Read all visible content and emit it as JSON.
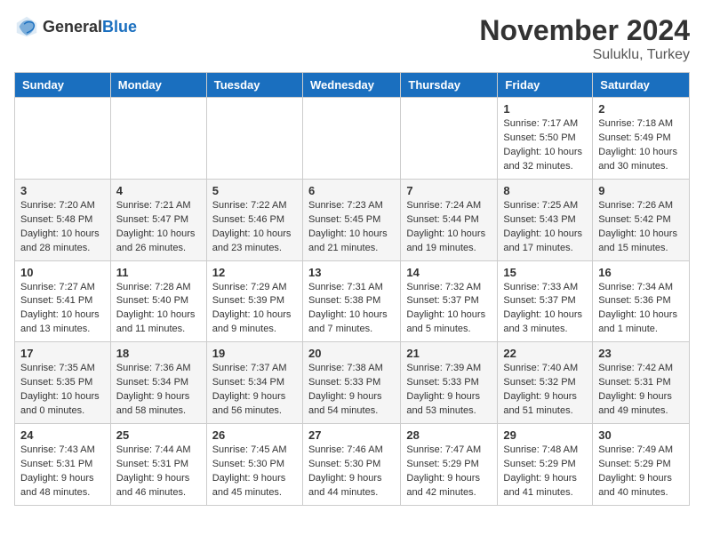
{
  "logo": {
    "text_general": "General",
    "text_blue": "Blue",
    "tagline": "GeneralBlue"
  },
  "title": "November 2024",
  "location": "Suluklu, Turkey",
  "days_of_week": [
    "Sunday",
    "Monday",
    "Tuesday",
    "Wednesday",
    "Thursday",
    "Friday",
    "Saturday"
  ],
  "rows": [
    [
      {
        "day": "",
        "info": ""
      },
      {
        "day": "",
        "info": ""
      },
      {
        "day": "",
        "info": ""
      },
      {
        "day": "",
        "info": ""
      },
      {
        "day": "",
        "info": ""
      },
      {
        "day": "1",
        "info": "Sunrise: 7:17 AM\nSunset: 5:50 PM\nDaylight: 10 hours and 32 minutes."
      },
      {
        "day": "2",
        "info": "Sunrise: 7:18 AM\nSunset: 5:49 PM\nDaylight: 10 hours and 30 minutes."
      }
    ],
    [
      {
        "day": "3",
        "info": "Sunrise: 7:20 AM\nSunset: 5:48 PM\nDaylight: 10 hours and 28 minutes."
      },
      {
        "day": "4",
        "info": "Sunrise: 7:21 AM\nSunset: 5:47 PM\nDaylight: 10 hours and 26 minutes."
      },
      {
        "day": "5",
        "info": "Sunrise: 7:22 AM\nSunset: 5:46 PM\nDaylight: 10 hours and 23 minutes."
      },
      {
        "day": "6",
        "info": "Sunrise: 7:23 AM\nSunset: 5:45 PM\nDaylight: 10 hours and 21 minutes."
      },
      {
        "day": "7",
        "info": "Sunrise: 7:24 AM\nSunset: 5:44 PM\nDaylight: 10 hours and 19 minutes."
      },
      {
        "day": "8",
        "info": "Sunrise: 7:25 AM\nSunset: 5:43 PM\nDaylight: 10 hours and 17 minutes."
      },
      {
        "day": "9",
        "info": "Sunrise: 7:26 AM\nSunset: 5:42 PM\nDaylight: 10 hours and 15 minutes."
      }
    ],
    [
      {
        "day": "10",
        "info": "Sunrise: 7:27 AM\nSunset: 5:41 PM\nDaylight: 10 hours and 13 minutes."
      },
      {
        "day": "11",
        "info": "Sunrise: 7:28 AM\nSunset: 5:40 PM\nDaylight: 10 hours and 11 minutes."
      },
      {
        "day": "12",
        "info": "Sunrise: 7:29 AM\nSunset: 5:39 PM\nDaylight: 10 hours and 9 minutes."
      },
      {
        "day": "13",
        "info": "Sunrise: 7:31 AM\nSunset: 5:38 PM\nDaylight: 10 hours and 7 minutes."
      },
      {
        "day": "14",
        "info": "Sunrise: 7:32 AM\nSunset: 5:37 PM\nDaylight: 10 hours and 5 minutes."
      },
      {
        "day": "15",
        "info": "Sunrise: 7:33 AM\nSunset: 5:37 PM\nDaylight: 10 hours and 3 minutes."
      },
      {
        "day": "16",
        "info": "Sunrise: 7:34 AM\nSunset: 5:36 PM\nDaylight: 10 hours and 1 minute."
      }
    ],
    [
      {
        "day": "17",
        "info": "Sunrise: 7:35 AM\nSunset: 5:35 PM\nDaylight: 10 hours and 0 minutes."
      },
      {
        "day": "18",
        "info": "Sunrise: 7:36 AM\nSunset: 5:34 PM\nDaylight: 9 hours and 58 minutes."
      },
      {
        "day": "19",
        "info": "Sunrise: 7:37 AM\nSunset: 5:34 PM\nDaylight: 9 hours and 56 minutes."
      },
      {
        "day": "20",
        "info": "Sunrise: 7:38 AM\nSunset: 5:33 PM\nDaylight: 9 hours and 54 minutes."
      },
      {
        "day": "21",
        "info": "Sunrise: 7:39 AM\nSunset: 5:33 PM\nDaylight: 9 hours and 53 minutes."
      },
      {
        "day": "22",
        "info": "Sunrise: 7:40 AM\nSunset: 5:32 PM\nDaylight: 9 hours and 51 minutes."
      },
      {
        "day": "23",
        "info": "Sunrise: 7:42 AM\nSunset: 5:31 PM\nDaylight: 9 hours and 49 minutes."
      }
    ],
    [
      {
        "day": "24",
        "info": "Sunrise: 7:43 AM\nSunset: 5:31 PM\nDaylight: 9 hours and 48 minutes."
      },
      {
        "day": "25",
        "info": "Sunrise: 7:44 AM\nSunset: 5:31 PM\nDaylight: 9 hours and 46 minutes."
      },
      {
        "day": "26",
        "info": "Sunrise: 7:45 AM\nSunset: 5:30 PM\nDaylight: 9 hours and 45 minutes."
      },
      {
        "day": "27",
        "info": "Sunrise: 7:46 AM\nSunset: 5:30 PM\nDaylight: 9 hours and 44 minutes."
      },
      {
        "day": "28",
        "info": "Sunrise: 7:47 AM\nSunset: 5:29 PM\nDaylight: 9 hours and 42 minutes."
      },
      {
        "day": "29",
        "info": "Sunrise: 7:48 AM\nSunset: 5:29 PM\nDaylight: 9 hours and 41 minutes."
      },
      {
        "day": "30",
        "info": "Sunrise: 7:49 AM\nSunset: 5:29 PM\nDaylight: 9 hours and 40 minutes."
      }
    ]
  ]
}
